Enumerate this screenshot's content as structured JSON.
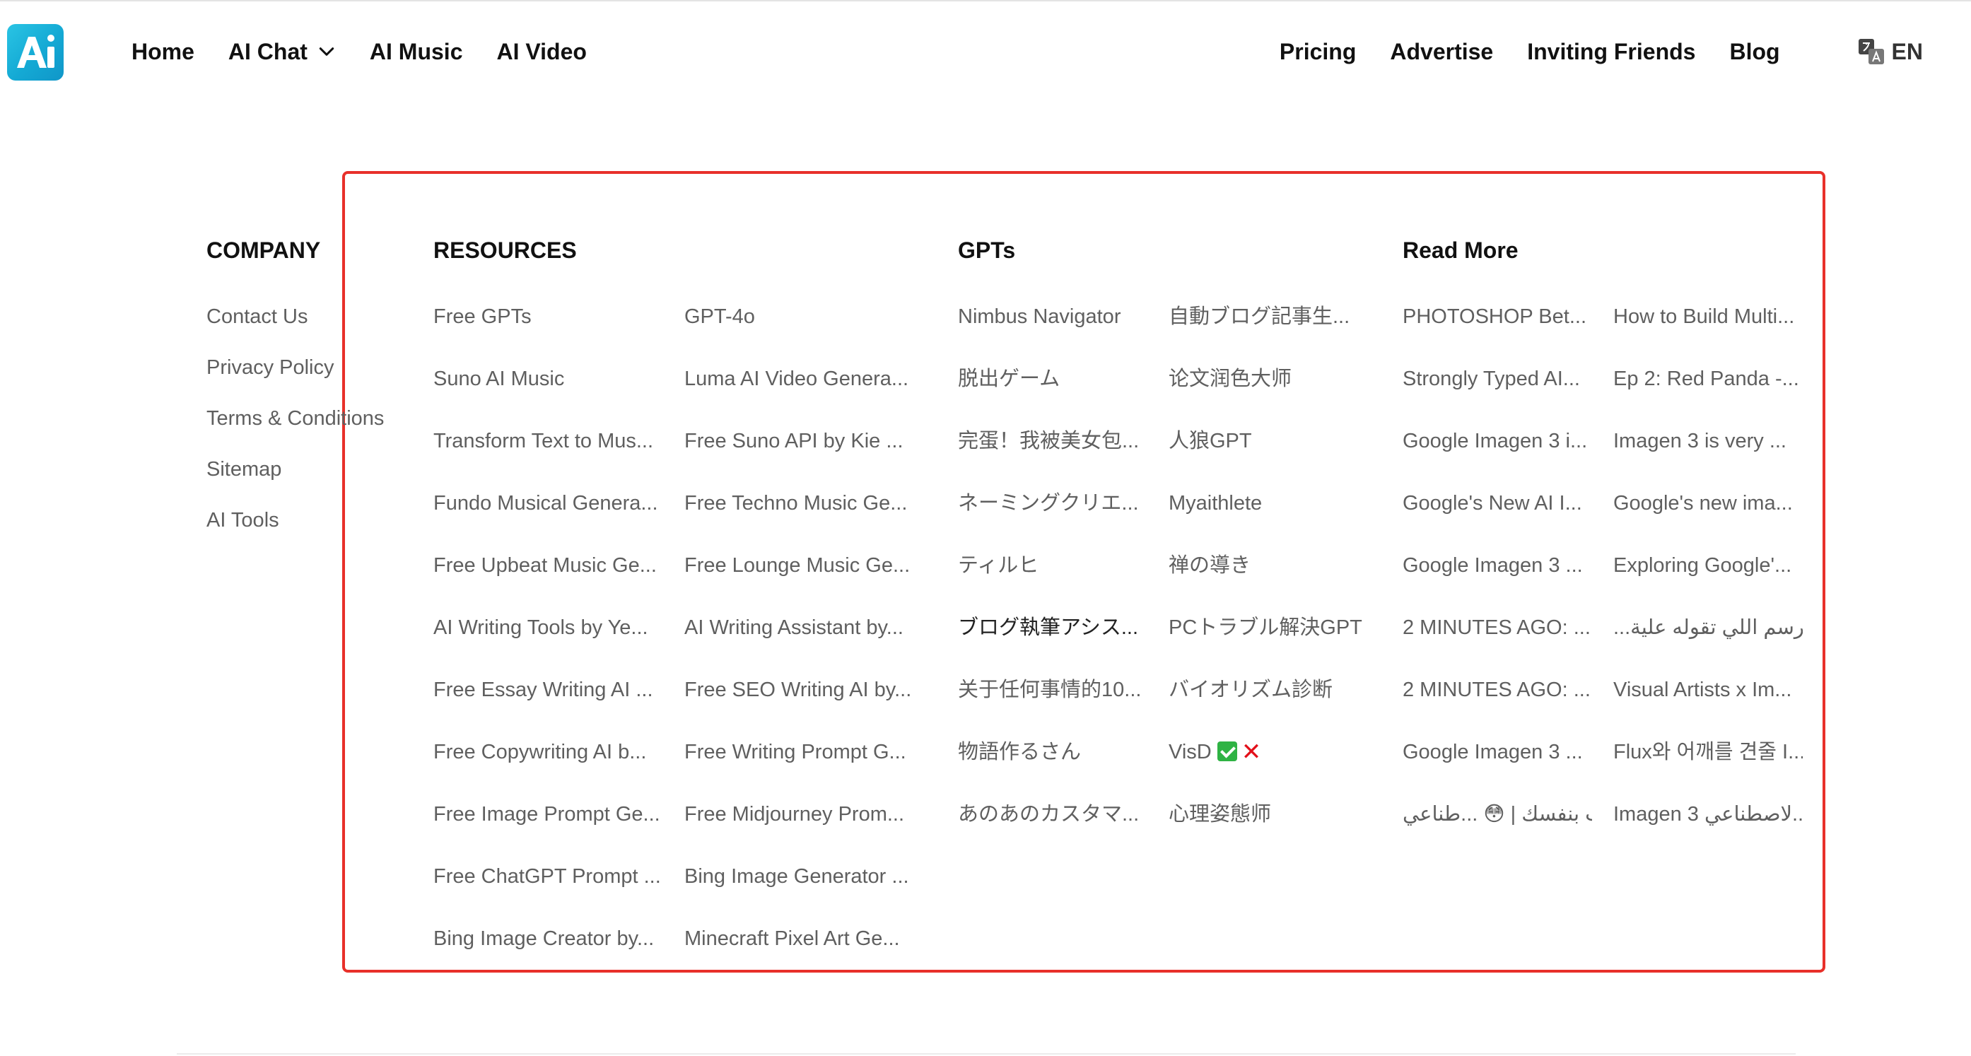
{
  "header": {
    "logo_text": "Ai",
    "nav_left": [
      "Home",
      "AI Chat",
      "AI Music",
      "AI Video"
    ],
    "nav_right": [
      "Pricing",
      "Advertise",
      "Inviting Friends",
      "Blog"
    ],
    "language": "EN"
  },
  "footer": {
    "company": {
      "title": "COMPANY",
      "links": [
        "Contact Us",
        "Privacy Policy",
        "Terms & Conditions",
        "Sitemap",
        "AI Tools"
      ]
    },
    "resources": {
      "title": "RESOURCES",
      "col1": [
        "Free GPTs",
        "Suno AI Music",
        "Transform Text to Mus...",
        "Fundo Musical Genera...",
        "Free Upbeat Music Ge...",
        "AI Writing Tools by Ye...",
        "Free Essay Writing AI ...",
        "Free Copywriting AI b...",
        "Free Image Prompt Ge...",
        "Free ChatGPT Prompt ...",
        "Bing Image Creator by..."
      ],
      "col2": [
        "GPT-4o",
        "Luma AI Video Genera...",
        "Free Suno API by Kie ...",
        "Free Techno Music Ge...",
        "Free Lounge Music Ge...",
        "AI Writing Assistant by...",
        "Free SEO Writing AI by...",
        "Free Writing Prompt G...",
        "Free Midjourney Prom...",
        "Bing Image Generator ...",
        "Minecraft Pixel Art Ge..."
      ]
    },
    "gpts": {
      "title": "GPTs",
      "col1": [
        "Nimbus Navigator",
        "脱出ゲーム",
        "完蛋！我被美女包...",
        "ネーミングクリエ...",
        "ティルヒ",
        "ブログ執筆アシス...",
        "关于任何事情的10...",
        "物語作るさん",
        "あのあのカスタマ..."
      ],
      "col2": [
        "自動ブログ記事生...",
        "论文润色大师",
        "人狼GPT",
        "Myaithlete",
        "禅の導き",
        "PCトラブル解決GPT",
        "バイオリズム診断",
        "VisD",
        "心理姿態师"
      ]
    },
    "read_more": {
      "title": "Read More",
      "col1": [
        "PHOTOSHOP Bet...",
        "Strongly Typed AI...",
        "Google Imagen 3 i...",
        "Google's New AI I...",
        "Google Imagen 3 ...",
        "2 MINUTES AGO: ...",
        "2 MINUTES AGO: ...",
        "Google Imagen 3 ...",
        "جرب بنفسك | 😳 ...طناعي"
      ],
      "col2": [
        "How to Build Multi...",
        "Ep 2: Red Panda -...",
        "Imagen 3 is very ...",
        "Google's new ima...",
        "Exploring Google'...",
        "...رة وبيرسم اللي تقوله علية",
        "Visual Artists x Im...",
        "Flux와 어깨를 견줄 I...",
        "Imagen 3 لاصطناعي..."
      ]
    }
  }
}
